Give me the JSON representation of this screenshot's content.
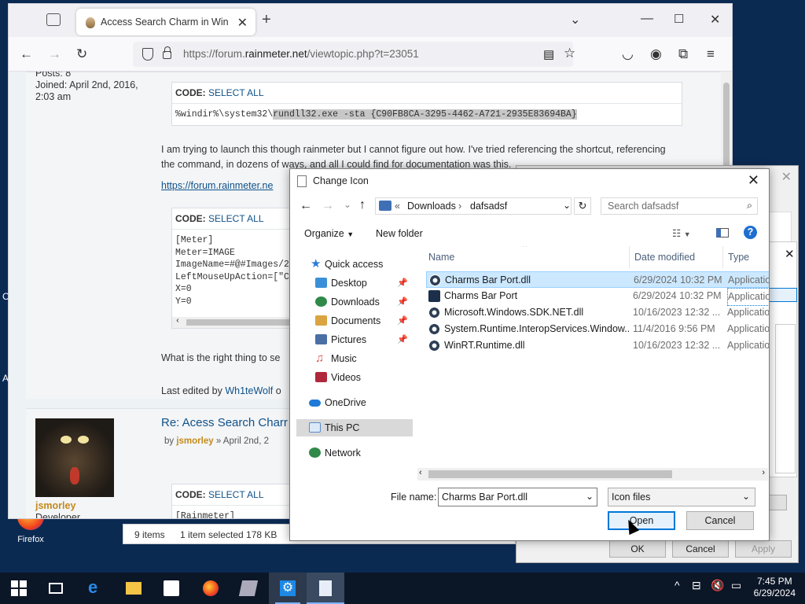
{
  "desktop": {
    "side_chars": [
      "C",
      "A"
    ],
    "icon_label": "Firefox"
  },
  "browser": {
    "tab_title": "Access Search Charm in Windo",
    "url_host_prefix": "https://forum.",
    "url_host": "rainmeter.net",
    "url_path": "/viewtopic.php?t=23051"
  },
  "post1": {
    "posts_label": "Posts: 8",
    "joined": "Joined: April 2nd, 2016, 2:03 am",
    "code1_header": "CODE: ",
    "select_all": "SELECT ALL",
    "code1_prefix": "%windir%\\system32\\",
    "code1_selected": "rundll32.exe -sta {C90FB8CA-3295-4462-A721-2935E83694BA}",
    "paragraph": "I am trying to launch this though rainmeter but I cannot figure out how. I've tried referencing the shortcut, referencing the command, in dozens of ways, and all I could find for documentation was this.",
    "doc_link": "https://forum.rainmeter.ne",
    "code2_header": "CODE: ",
    "code2_lines": "[Meter]\nMeter=IMAGE\nImageName=#@#Images/2\nLeftMouseUpAction=[\"C\nX=0\nY=0",
    "question": "What is the right thing to se",
    "last_edited_prefix": "Last edited by ",
    "last_edited_user": "Wh1teWolf",
    "last_edited_suffix": " o"
  },
  "post2": {
    "title": "Re: Acess Search Charr",
    "by_prefix": "by ",
    "author": "jsmorley",
    "date": " » April 2nd, 2",
    "username": "jsmorley",
    "role": "Developer",
    "code_header": "CODE: ",
    "code_line": "[Rainmeter]"
  },
  "explorer_status": {
    "items": "9 items",
    "selected": "1 item selected  178 KB"
  },
  "bg_dialog": {
    "ok": "OK",
    "cancel": "Cancel",
    "apply": "Apply"
  },
  "dialog": {
    "title": "Change Icon",
    "breadcrumb_sep": "«",
    "path": [
      "Downloads",
      "dafsadsf"
    ],
    "search_placeholder": "Search dafsadsf",
    "organize": "Organize",
    "new_folder": "New folder",
    "nav": [
      {
        "label": "Quick access",
        "pinned": false,
        "color": "#2b7bd6"
      },
      {
        "label": "Desktop",
        "pinned": true,
        "color": "#3b8fd9"
      },
      {
        "label": "Downloads",
        "pinned": true,
        "color": "#2f8a4a"
      },
      {
        "label": "Documents",
        "pinned": true,
        "color": "#d9a441"
      },
      {
        "label": "Pictures",
        "pinned": true,
        "color": "#4a6fa5"
      },
      {
        "label": "Music",
        "pinned": false,
        "color": "#d9534f"
      },
      {
        "label": "Videos",
        "pinned": false,
        "color": "#b0283b"
      },
      {
        "label": "OneDrive",
        "pinned": false,
        "color": "#1e7ad8"
      },
      {
        "label": "This PC",
        "pinned": false,
        "color": "#5b8cc9"
      },
      {
        "label": "Network",
        "pinned": false,
        "color": "#2f8a4a"
      }
    ],
    "columns": {
      "name": "Name",
      "date": "Date modified",
      "type": "Type"
    },
    "files": [
      {
        "name": "Charms Bar Port.dll",
        "date": "6/29/2024 10:32 PM",
        "type": "Applicatio"
      },
      {
        "name": "Charms Bar Port",
        "date": "6/29/2024 10:32 PM",
        "type": "Applicatio"
      },
      {
        "name": "Microsoft.Windows.SDK.NET.dll",
        "date": "10/16/2023 12:32 ...",
        "type": "Applicatio"
      },
      {
        "name": "System.Runtime.InteropServices.Window...",
        "date": "11/4/2016 9:56 PM",
        "type": "Applicatio"
      },
      {
        "name": "WinRT.Runtime.dll",
        "date": "10/16/2023 12:32 ...",
        "type": "Applicatio"
      }
    ],
    "filename_label": "File name:",
    "filename_value": "Charms Bar Port.dll",
    "filetype_value": "Icon files",
    "open": "Open",
    "cancel": "Cancel"
  },
  "taskbar": {
    "time": "7:45 PM",
    "date": "6/29/2024"
  }
}
